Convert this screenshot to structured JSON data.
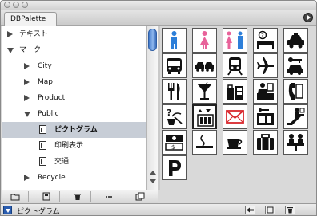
{
  "panel": {
    "tab_label": "DBPalette",
    "menu_icon": "panel-menu-icon"
  },
  "tree": {
    "items": [
      {
        "label": "テキスト",
        "level": 0,
        "kind": "folder",
        "expanded": false
      },
      {
        "label": "マーク",
        "level": 0,
        "kind": "folder",
        "expanded": true
      },
      {
        "label": "City",
        "level": 1,
        "kind": "folder",
        "expanded": false
      },
      {
        "label": "Map",
        "level": 1,
        "kind": "folder",
        "expanded": false
      },
      {
        "label": "Product",
        "level": 1,
        "kind": "folder",
        "expanded": false
      },
      {
        "label": "Public",
        "level": 1,
        "kind": "folder",
        "expanded": true
      },
      {
        "label": "ピクトグラム",
        "level": 2,
        "kind": "document",
        "selected": true
      },
      {
        "label": "印刷表示",
        "level": 2,
        "kind": "document"
      },
      {
        "label": "交通",
        "level": 2,
        "kind": "document"
      },
      {
        "label": "Recycle",
        "level": 1,
        "kind": "folder",
        "expanded": false
      }
    ]
  },
  "pictograms": [
    "man-toilet-icon",
    "woman-toilet-icon",
    "restroom-icon",
    "hotel-icon",
    "taxi-icon",
    "bus-icon",
    "car-rental-icon",
    "railway-icon",
    "airport-icon",
    "car-key-icon",
    "restaurant-icon",
    "bar-icon",
    "shop-icon",
    "information-desk-icon",
    "telephone-icon",
    "lost-found-icon",
    "elevator-icon",
    "mail-icon",
    "locker-icon",
    "escalator-icon",
    "money-exchange-icon",
    "smoking-area-icon",
    "coffee-icon",
    "baggage-icon",
    "reception-icon",
    "parking-icon"
  ],
  "colors": {
    "man": "#2d7fd9",
    "woman": "#e8629a",
    "mail_red": "#d8262c",
    "selection": "#c7cdd6",
    "scroll_thumb": "#5a8fd8"
  },
  "toolbar": {
    "buttons": [
      "new-folder-icon",
      "new-document-icon",
      "trash-icon",
      "more-icon",
      "duplicate-icon"
    ]
  },
  "status": {
    "selected_label": "ピクトグラム",
    "buttons": [
      "import-icon",
      "new-item-icon",
      "trash-icon"
    ]
  }
}
